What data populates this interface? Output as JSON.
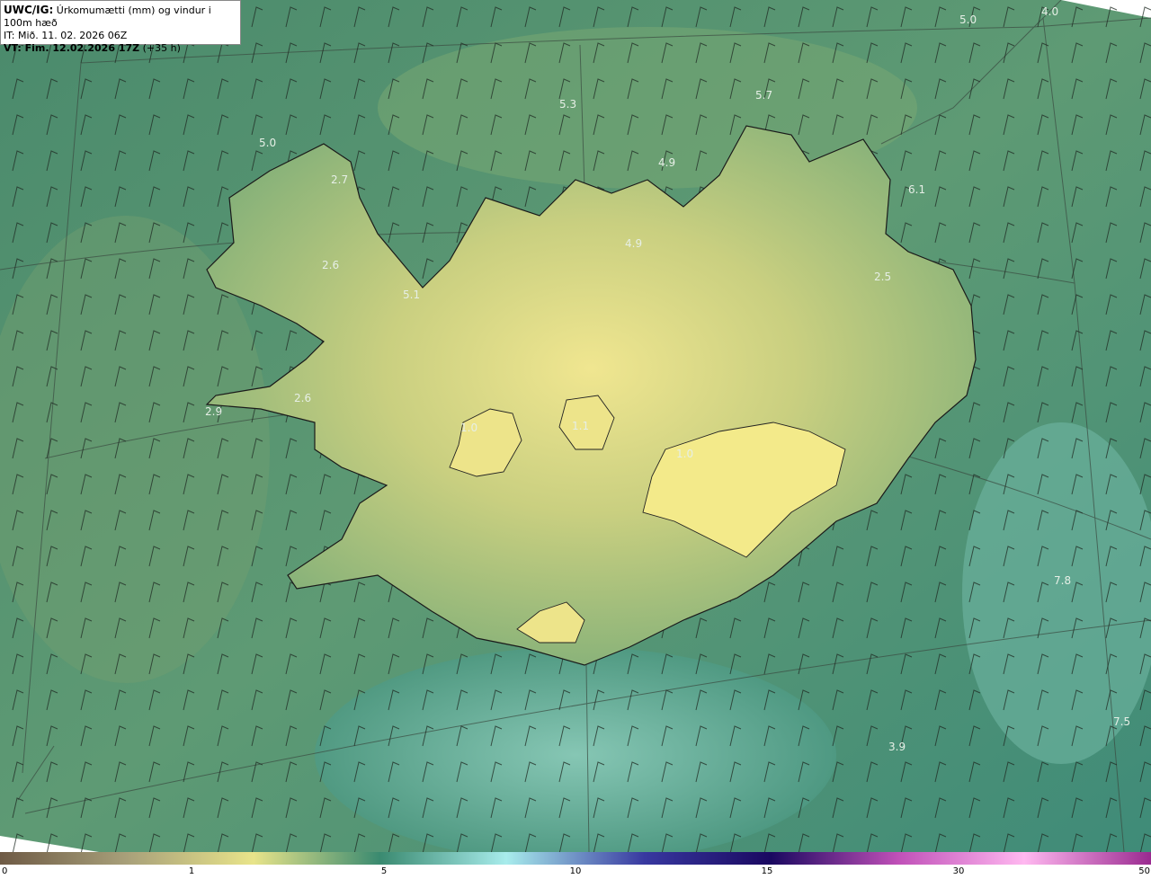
{
  "header": {
    "model": "UWC/IG:",
    "title": "Úrkomumætti (mm) og vindur i 100m hæð",
    "init_time": "IT: Mið. 11. 02. 2026 06Z",
    "valid_prefix": "VT: Fim. 12.02.2026 17Z",
    "valid_suffix": "(+35 h)"
  },
  "map_values": [
    {
      "text": "4.0"
    },
    {
      "text": "5.0"
    },
    {
      "text": "5.3"
    },
    {
      "text": "5.7"
    },
    {
      "text": "5.0"
    },
    {
      "text": "4.9"
    },
    {
      "text": "2.7"
    },
    {
      "text": "6.1"
    },
    {
      "text": "4.9"
    },
    {
      "text": "2.6"
    },
    {
      "text": "5.1"
    },
    {
      "text": "2.5"
    },
    {
      "text": "2.6"
    },
    {
      "text": "2.9"
    },
    {
      "text": "1.1"
    },
    {
      "text": "1.0"
    },
    {
      "text": "1.0"
    },
    {
      "text": "7.8"
    },
    {
      "text": "7.5"
    },
    {
      "text": "3.9"
    }
  ],
  "colorbar": {
    "ticks": [
      "0",
      "1",
      "5",
      "10",
      "15",
      "30",
      "50"
    ],
    "colors": [
      "#6e5a45",
      "#a8a07a",
      "#e8e48a",
      "#3a8a70",
      "#a8ecec",
      "#3838a0",
      "#1a0860",
      "#c050b8",
      "#ffb8f0",
      "#9a2a90"
    ]
  }
}
